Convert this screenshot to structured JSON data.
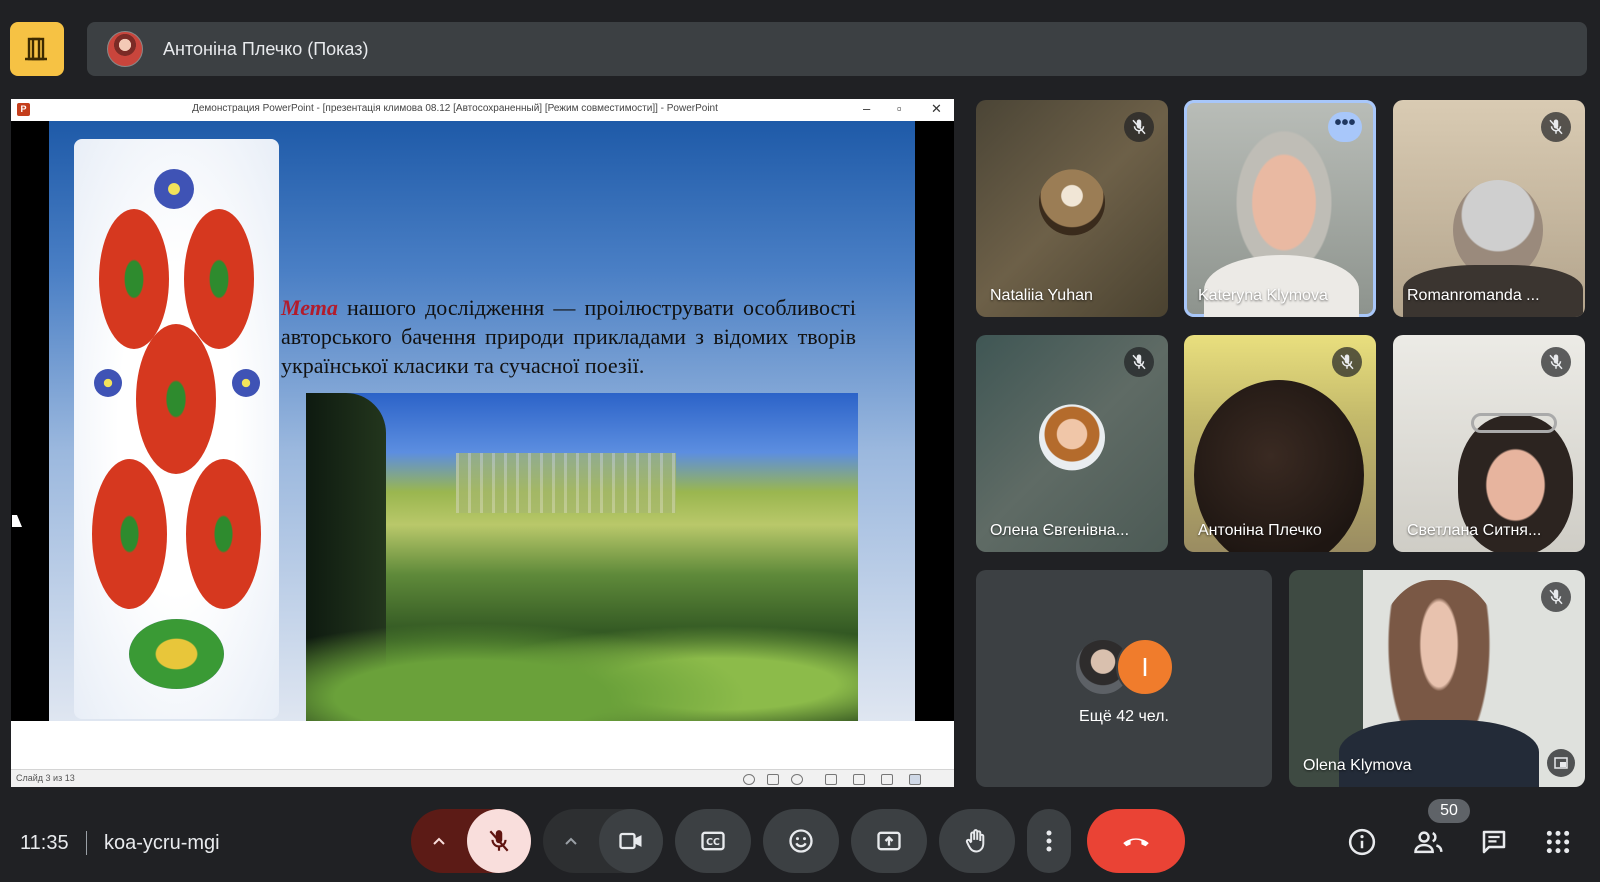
{
  "top_bar": {
    "presenter_label": "Антоніна Плечко (Показ)"
  },
  "presentation": {
    "window_title": "Демонстрация PowerPoint - [презентація климова 08.12 [Автосохраненный] [Режим совместимости]] - PowerPoint",
    "slide_accent_word": "Мета",
    "slide_text": "нашого дослідження — проілюструвати особливості авторського бачення природи прикладами з відомих творів української класики та сучасної поезії.",
    "slide_counter": "Слайд 3 из 13"
  },
  "participants": [
    {
      "name": "Nataliia Yuhan",
      "muted": true
    },
    {
      "name": "Kateryna Klymova",
      "muted": false,
      "speaking": true
    },
    {
      "name": "Romanromanda ...",
      "muted": true
    },
    {
      "name": "Олена Євгенівна...",
      "muted": true
    },
    {
      "name": "Антоніна Плечко",
      "muted": true
    },
    {
      "name": "Светлана Ситня...",
      "muted": true
    },
    {
      "name": "Olena Klymova",
      "muted": true
    }
  ],
  "others_tile": {
    "label": "Ещё 42 чел.",
    "avatar_letter": "I"
  },
  "bottom_bar": {
    "time": "11:35",
    "meeting_code": "koa-ycru-mgi",
    "participant_count": "50"
  },
  "colors": {
    "background": "#202124",
    "surface": "#3c4043",
    "accent_yellow": "#f6c244",
    "end_call_red": "#ea4335",
    "mic_off_pink": "#f9dedc",
    "active_border": "#a8c7fa"
  }
}
